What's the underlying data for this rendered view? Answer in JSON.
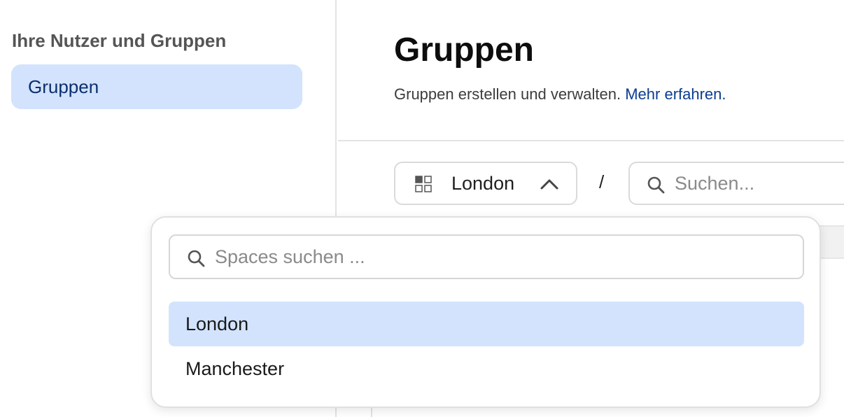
{
  "sidebar": {
    "heading": "Ihre Nutzer und Gruppen",
    "items": [
      {
        "label": "Gruppen",
        "selected": true
      }
    ]
  },
  "header": {
    "title": "Gruppen",
    "description": "Gruppen erstellen und verwalten.",
    "link": "Mehr erfahren."
  },
  "toolbar": {
    "space_select": {
      "icon": "grid-icon",
      "value": "London",
      "state_icon": "chevron-up-icon"
    },
    "separator": "/",
    "search": {
      "icon": "search-icon",
      "placeholder": "Suchen..."
    }
  },
  "space_popup": {
    "search": {
      "icon": "search-icon",
      "placeholder": "Spaces suchen ...",
      "value": ""
    },
    "options": [
      {
        "label": "London",
        "selected": true
      },
      {
        "label": "Manchester",
        "selected": false
      }
    ]
  },
  "colors": {
    "accent_bg": "#d3e3fd",
    "link": "#0b3d91",
    "sidebar_text": "#0b2f6e",
    "border": "#dadada"
  }
}
